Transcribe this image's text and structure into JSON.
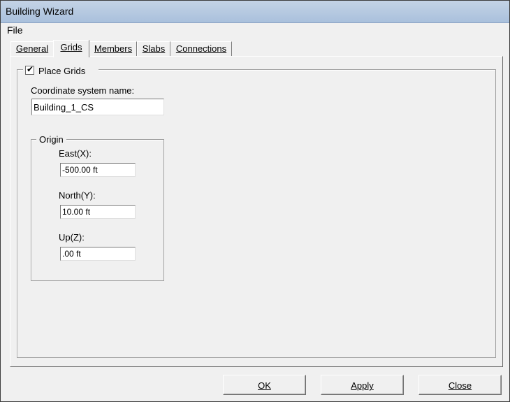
{
  "window": {
    "title": "Building Wizard"
  },
  "menubar": {
    "file": "File"
  },
  "tabs": [
    {
      "label": "General"
    },
    {
      "label": "Grids"
    },
    {
      "label": "Members"
    },
    {
      "label": "Slabs"
    },
    {
      "label": "Connections"
    }
  ],
  "active_tab": "Grids",
  "grids": {
    "place_grids_label": "Place Grids",
    "place_grids_checked": true,
    "cs_label": "Coordinate system name:",
    "cs_value": "Building_1_CS",
    "origin": {
      "legend": "Origin",
      "east_label": "East(X):",
      "east_value": "-500.00 ft",
      "north_label": "North(Y):",
      "north_value": "10.00 ft",
      "up_label": "Up(Z):",
      "up_value": ".00 ft"
    }
  },
  "buttons": {
    "ok": "OK",
    "apply": "Apply",
    "close": "Close"
  }
}
